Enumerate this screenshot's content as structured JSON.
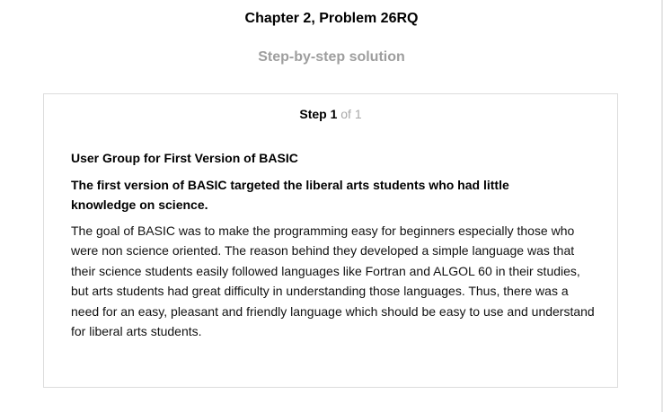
{
  "header": {
    "title": "Chapter 2, Problem 26RQ",
    "subtitle": "Step-by-step solution"
  },
  "step": {
    "label": "Step 1",
    "of_text": "of 1",
    "section_title": "User Group for First Version of BASIC",
    "lead": "The first version of BASIC targeted the liberal arts students who had little knowledge on science.",
    "body": "The goal of BASIC was to make the programming easy for beginners especially those who were non science oriented. The reason behind they developed a simple language was that their science students easily followed languages like Fortran and ALGOL 60 in their studies, but arts students had great difficulty in understanding those languages. Thus, there was a need for an easy, pleasant and friendly language which should be easy to use and understand for liberal arts students."
  },
  "colors": {
    "muted_text": "#9e9e9e",
    "card_border": "#dcdcdc"
  }
}
